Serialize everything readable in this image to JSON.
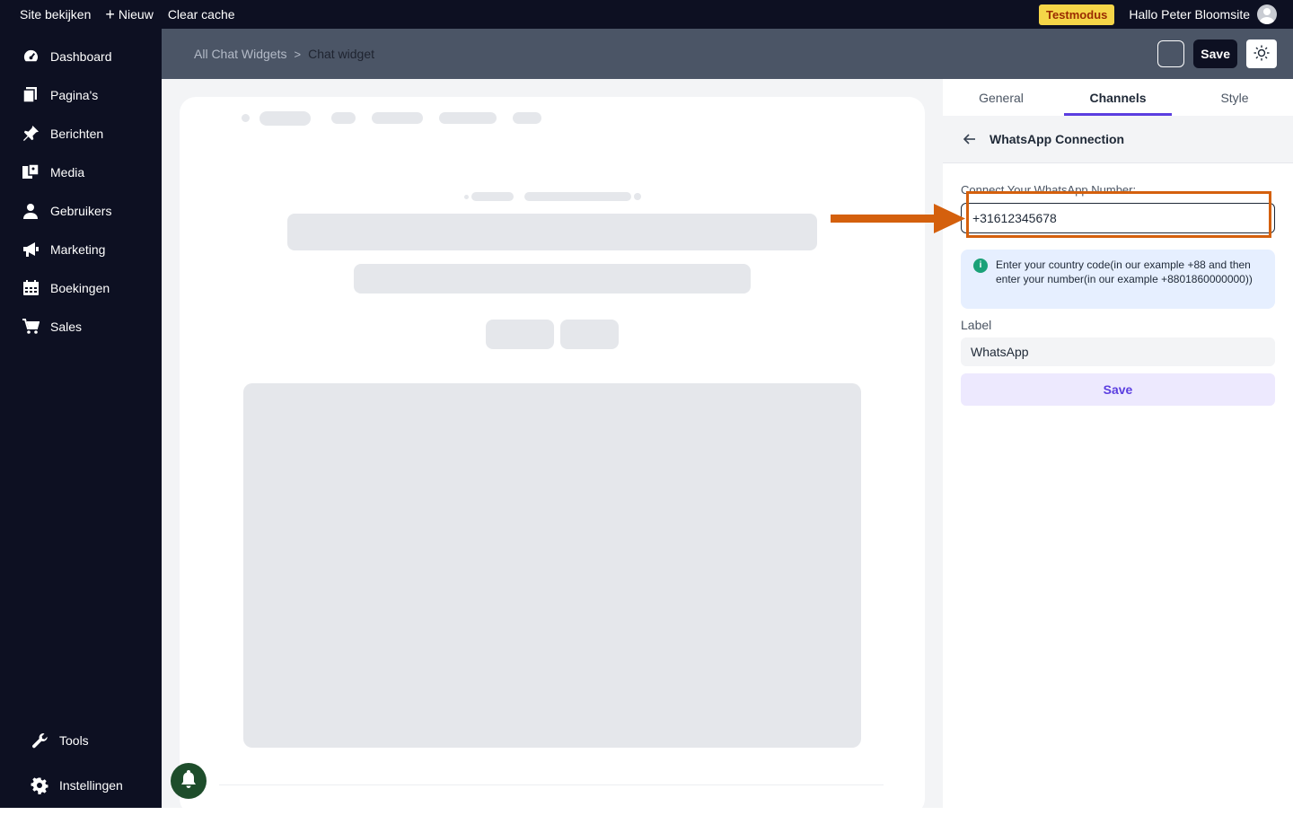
{
  "topbar": {
    "view_site": "Site bekijken",
    "new": "Nieuw",
    "clear_cache": "Clear cache",
    "test_mode": "Testmodus",
    "greeting": "Hallo Peter Bloomsite"
  },
  "sidebar": {
    "items": [
      {
        "label": "Dashboard",
        "icon": "dashboard-icon"
      },
      {
        "label": "Pagina's",
        "icon": "pages-icon"
      },
      {
        "label": "Berichten",
        "icon": "pin-icon"
      },
      {
        "label": "Media",
        "icon": "media-icon"
      },
      {
        "label": "Gebruikers",
        "icon": "user-icon"
      },
      {
        "label": "Marketing",
        "icon": "megaphone-icon"
      },
      {
        "label": "Boekingen",
        "icon": "calendar-icon"
      },
      {
        "label": "Sales",
        "icon": "cart-icon"
      }
    ],
    "bottom": [
      {
        "label": "Tools",
        "icon": "wrench-icon"
      },
      {
        "label": "Instellingen",
        "icon": "gear-icon"
      }
    ]
  },
  "header": {
    "breadcrumb_parent": "All Chat Widgets",
    "breadcrumb_separator": ">",
    "breadcrumb_current": "Chat widget",
    "save_label": "Save"
  },
  "panel": {
    "tabs": [
      {
        "label": "General",
        "active": false
      },
      {
        "label": "Channels",
        "active": true
      },
      {
        "label": "Style",
        "active": false
      }
    ],
    "title": "WhatsApp Connection",
    "connect_label": "Connect Your WhatsApp Number:",
    "phone_value": "+31612345678",
    "info_text": "Enter your country code(in our example +88 and then enter your number(in our example +8801860000000))",
    "label_title": "Label",
    "label_value": "WhatsApp",
    "save_label": "Save"
  },
  "colors": {
    "accent": "#5b3ee0",
    "highlight": "#d4600d",
    "sidebar_bg": "#0d1022"
  }
}
